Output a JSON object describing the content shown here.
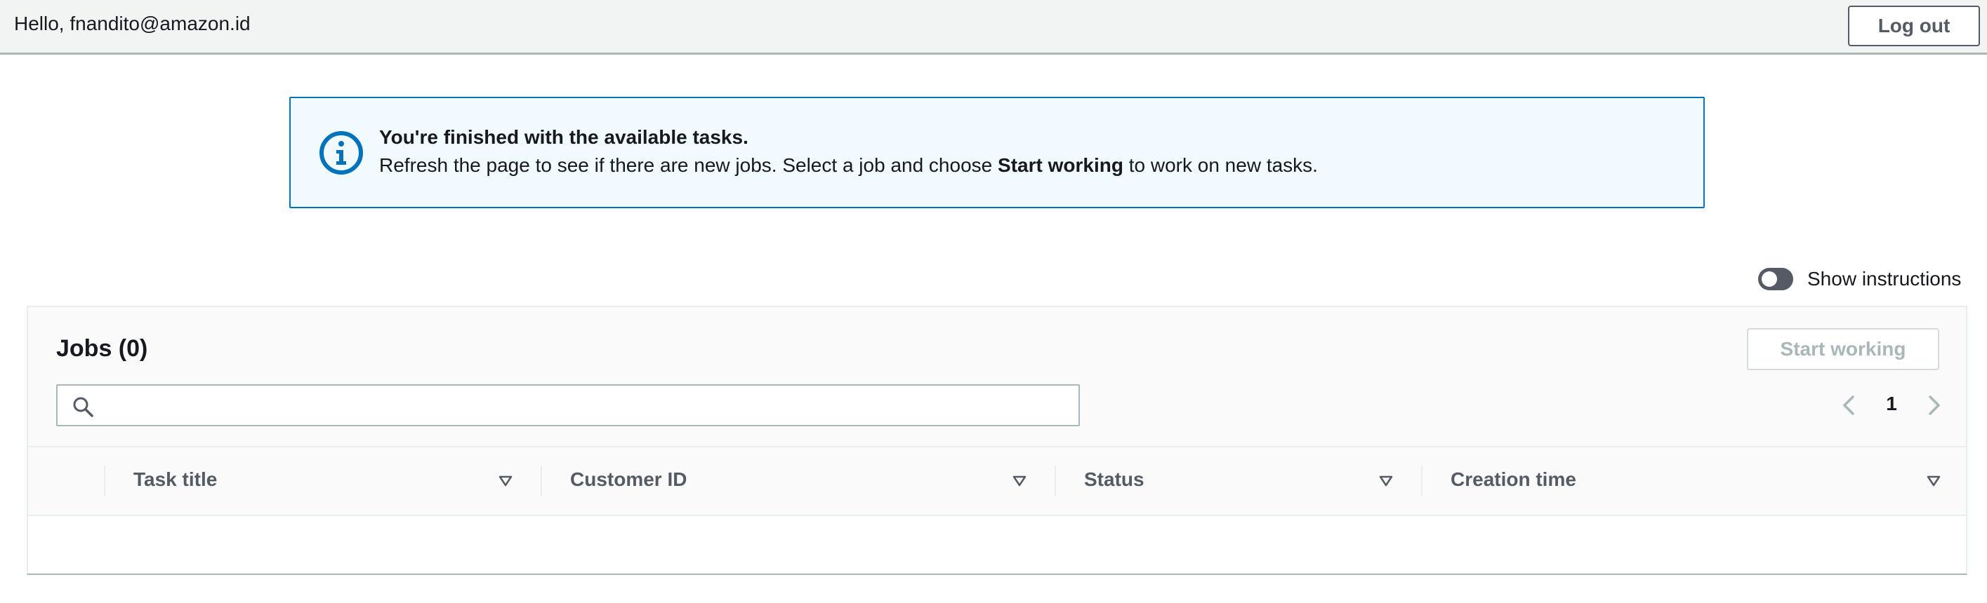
{
  "header": {
    "greeting": "Hello, fnandito@amazon.id",
    "logout_label": "Log out"
  },
  "flash": {
    "type": "info",
    "icon": "info-icon",
    "title": "You're finished with the available tasks.",
    "body_prefix": "Refresh the page to see if there are new jobs. Select a job and choose ",
    "body_bold": "Start working",
    "body_suffix": " to work on new tasks."
  },
  "instructions_toggle": {
    "label": "Show instructions",
    "checked": false
  },
  "jobs": {
    "title": "Jobs (0)",
    "start_working_label": "Start working",
    "start_working_disabled": true,
    "search": {
      "value": "",
      "placeholder": ""
    },
    "pagination": {
      "current_page": "1"
    },
    "columns": [
      {
        "label": "Task title",
        "sort_icon": "caret-down-outline-icon"
      },
      {
        "label": "Customer ID",
        "sort_icon": "caret-down-outline-icon"
      },
      {
        "label": "Status",
        "sort_icon": "caret-down-outline-icon"
      },
      {
        "label": "Creation time",
        "sort_icon": "caret-down-outline-icon"
      }
    ],
    "rows": []
  },
  "colors": {
    "topbar_bg": "#f2f3f3",
    "info_border": "#0073bb",
    "info_bg": "#f1faff",
    "icon_blue": "#0073bb",
    "text": "#16191f",
    "secondary_text": "#545b64",
    "disabled_text": "#aab7b8"
  }
}
